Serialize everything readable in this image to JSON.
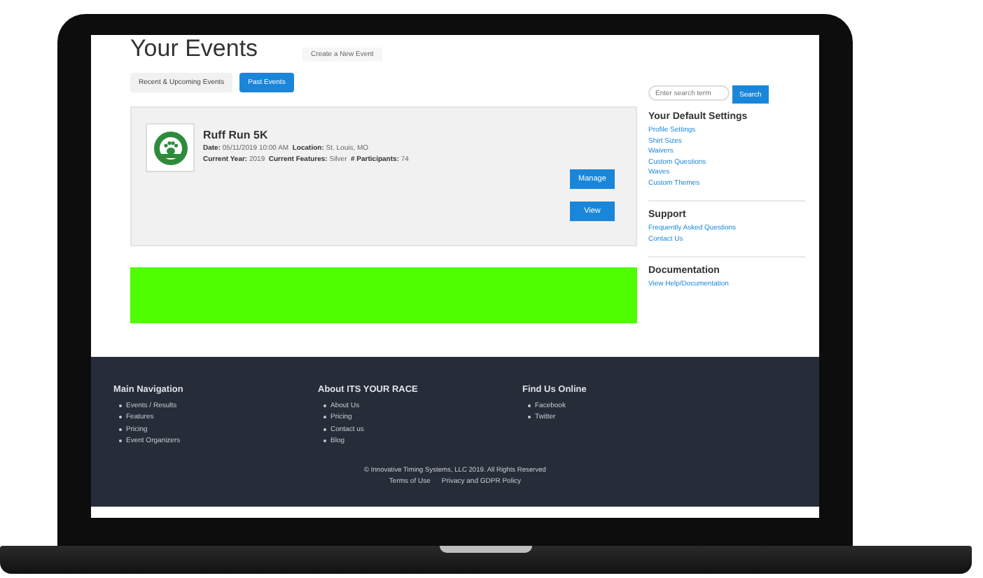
{
  "page": {
    "title": "Your Events",
    "create_button": "Create a New Event"
  },
  "tabs": [
    {
      "label": "Recent & Upcoming Events",
      "selected": false
    },
    {
      "label": "Past Events",
      "selected": true
    }
  ],
  "event": {
    "name": "Ruff Run 5K",
    "details": [
      "**Date:** 05/11/2019 10:00 AM  **Location:** St. Louis, MO",
      "**Current Year:** 2019  **Current Features:** Silver  **# Participants:** 74"
    ],
    "buttons": [
      "Manage",
      "View"
    ]
  },
  "search": {
    "placeholder": "Enter search term",
    "button": "Search"
  },
  "sidebar": [
    {
      "title": "Your Default Settings",
      "links": [
        "Profile Settings",
        "Shirt Sizes",
        "Waivers",
        "Custom Questions",
        "Waves",
        "Custom Themes"
      ]
    },
    {
      "title": "Support",
      "links": [
        "Frequently Asked Questions",
        "Contact Us"
      ]
    },
    {
      "title": "Documentation",
      "links": [
        "View Help/Documentation"
      ]
    }
  ],
  "footer": {
    "columns": [
      {
        "title": "Main Navigation",
        "items": [
          "Events / Results",
          "Features",
          "Pricing",
          "Event Organizers"
        ]
      },
      {
        "title": "About ITS YOUR RACE",
        "items": [
          "About Us",
          "Pricing",
          "Contact us",
          "Blog"
        ]
      },
      {
        "title": "Find Us Online",
        "items": [
          "Facebook",
          "Twitter"
        ]
      }
    ],
    "copyright": "© Innovative Timing Systems, LLC 2019. All Rights Reserved",
    "links": [
      "Terms of Use",
      "Privacy and GDPR Policy"
    ]
  }
}
